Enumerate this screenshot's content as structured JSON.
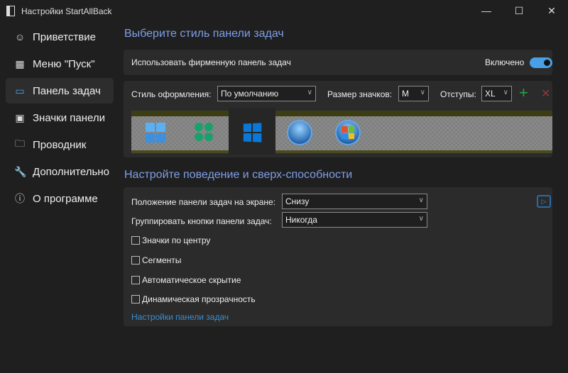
{
  "window": {
    "title": "Настройки StartAllBack",
    "minimize": "—",
    "maximize": "☐",
    "close": "✕"
  },
  "sidebar": {
    "items": [
      {
        "label": "Приветствие",
        "icon": "☺"
      },
      {
        "label": "Меню \"Пуск\"",
        "icon": "▦"
      },
      {
        "label": "Панель задач",
        "icon": "▭"
      },
      {
        "label": "Значки панели",
        "icon": "▣"
      },
      {
        "label": "Проводник",
        "icon": "🗀"
      },
      {
        "label": "Дополнительно",
        "icon": "🔧"
      },
      {
        "label": "О программе",
        "icon": "ⓘ"
      }
    ]
  },
  "section1": {
    "heading": "Выберите стиль панели задач",
    "use_branded": "Использовать фирменную панель задач",
    "toggle_state": "Включено",
    "style_label": "Стиль оформления:",
    "style_value": "По умолчанию",
    "size_label": "Размер значков:",
    "size_value": "M",
    "padding_label": "Отступы:",
    "padding_value": "XL",
    "add": "+",
    "remove": "✕"
  },
  "section2": {
    "heading": "Настройте поведение и сверх-способности",
    "position_label": "Положение панели задач на экране:",
    "position_value": "Снизу",
    "group_label": "Группировать кнопки панели задач:",
    "group_value": "Никогда",
    "checkboxes": [
      "Значки по центру",
      "Сегменты",
      "Автоматическое скрытие",
      "Динамическая прозрачность"
    ],
    "link": "Настройки панели задач"
  },
  "colors": {
    "accent": "#4aa0e6",
    "heading": "#7f9fe8",
    "add": "#2ea043",
    "remove": "#8b3a3a"
  }
}
